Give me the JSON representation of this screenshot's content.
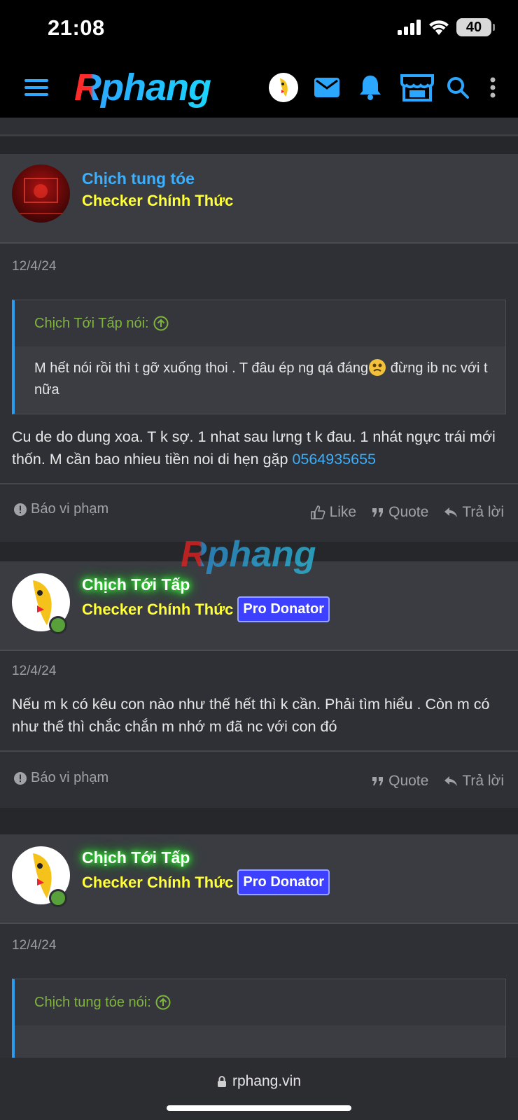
{
  "status": {
    "time": "21:08",
    "battery": "40"
  },
  "header": {
    "logo": "Rphang",
    "icons": [
      "menu-icon",
      "avatar",
      "mail-icon",
      "bell-icon",
      "store-icon",
      "search-icon",
      "more-icon"
    ],
    "accent": "#2ca7ff"
  },
  "posts": [
    {
      "username": "Chịch tung tóe",
      "title": "Checker Chính Thức",
      "date": "12/4/24",
      "quote_author": "Chịch Tới Tấp nói:",
      "quote_text": "M hết nói rồi thì t gỡ xuống thoi . T đâu ép ng qá đáng",
      "quote_text2": " đừng ib nc với t nữa",
      "message": "Cu de do dung xoa. T k sợ. 1 nhat sau lưng t k đau. 1 nhát ngực trái mới thốn. M cần bao nhieu tiền noi di hẹn gặp ",
      "message_link": "0564935655",
      "report": "Báo vi phạm",
      "like": "Like",
      "quote": "Quote",
      "reply": "Trả lời"
    },
    {
      "username": "Chịch Tới Tấp",
      "title": "Checker Chính Thức",
      "badge": "Pro Donator",
      "date": "12/4/24",
      "message": "Nếu m k có kêu con nào như thế hết thì k cần. Phải tìm hiểu . Còn m có như thế thì chắc chắn m nhớ m đã nc với con đó",
      "report": "Báo vi phạm",
      "quote": "Quote",
      "reply": "Trả lời"
    },
    {
      "username": "Chịch Tới Tấp",
      "title": "Checker Chính Thức",
      "badge": "Pro Donator",
      "date": "12/4/24",
      "quote_author": "Chịch tung tóe nói:"
    }
  ],
  "watermark": "Rphang",
  "browser": {
    "url": "rphang.vin"
  }
}
